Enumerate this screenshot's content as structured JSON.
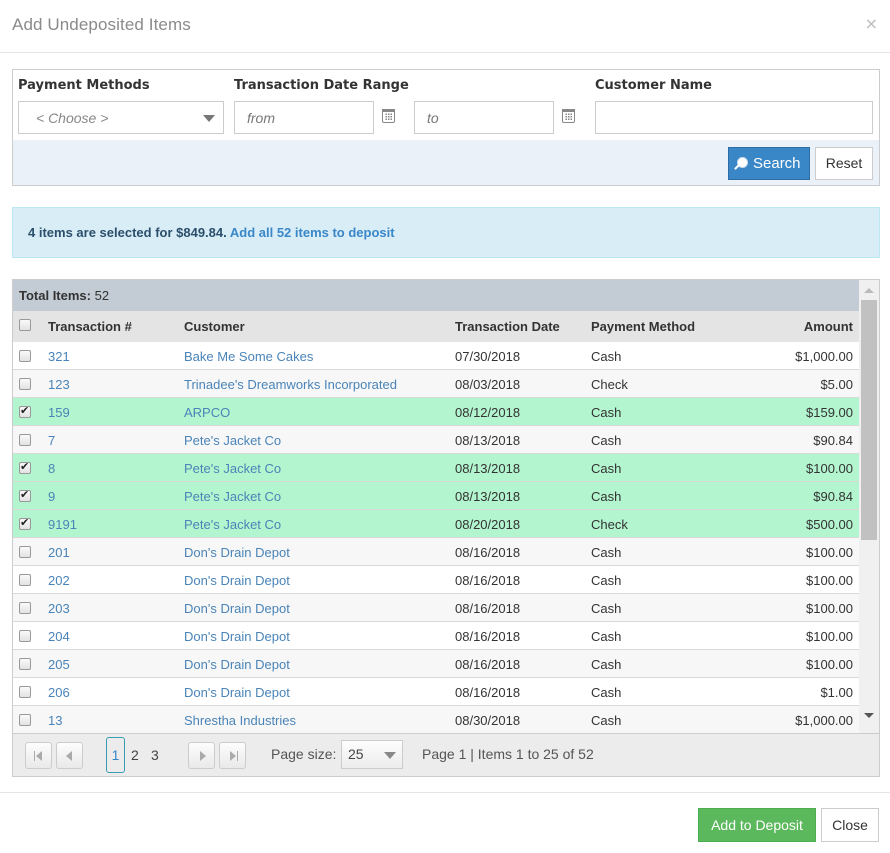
{
  "dialog": {
    "title": "Add Undeposited Items",
    "close_glyph": "×"
  },
  "filters": {
    "payment_methods": {
      "label": "Payment Methods",
      "value": "< Choose >"
    },
    "date_range": {
      "label": "Transaction Date Range",
      "from_placeholder": "from",
      "to_placeholder": "to"
    },
    "customer_name": {
      "label": "Customer Name",
      "value": ""
    },
    "search_label": "Search",
    "reset_label": "Reset"
  },
  "alert": {
    "text": "4 items are selected for $849.84.",
    "link": "Add all 52 items to deposit"
  },
  "grid": {
    "total_label": "Total Items:",
    "total_value": "52",
    "columns": [
      "Transaction #",
      "Customer",
      "Transaction Date",
      "Payment Method",
      "Amount"
    ],
    "rows": [
      {
        "selected": false,
        "txn": "321",
        "customer": "Bake Me Some Cakes",
        "date": "07/30/2018",
        "method": "Cash",
        "amount": "$1,000.00"
      },
      {
        "selected": false,
        "txn": "123",
        "customer": "Trinadee's Dreamworks Incorporated",
        "date": "08/03/2018",
        "method": "Check",
        "amount": "$5.00"
      },
      {
        "selected": true,
        "txn": "159",
        "customer": "ARPCO",
        "date": "08/12/2018",
        "method": "Cash",
        "amount": "$159.00"
      },
      {
        "selected": false,
        "txn": "7",
        "customer": "Pete's Jacket Co",
        "date": "08/13/2018",
        "method": "Cash",
        "amount": "$90.84"
      },
      {
        "selected": true,
        "txn": "8",
        "customer": "Pete's Jacket Co",
        "date": "08/13/2018",
        "method": "Cash",
        "amount": "$100.00"
      },
      {
        "selected": true,
        "txn": "9",
        "customer": "Pete's Jacket Co",
        "date": "08/13/2018",
        "method": "Cash",
        "amount": "$90.84"
      },
      {
        "selected": true,
        "txn": "9191",
        "customer": "Pete's Jacket Co",
        "date": "08/20/2018",
        "method": "Check",
        "amount": "$500.00"
      },
      {
        "selected": false,
        "txn": "201",
        "customer": "Don's Drain Depot",
        "date": "08/16/2018",
        "method": "Cash",
        "amount": "$100.00"
      },
      {
        "selected": false,
        "txn": "202",
        "customer": "Don's Drain Depot",
        "date": "08/16/2018",
        "method": "Cash",
        "amount": "$100.00"
      },
      {
        "selected": false,
        "txn": "203",
        "customer": "Don's Drain Depot",
        "date": "08/16/2018",
        "method": "Cash",
        "amount": "$100.00"
      },
      {
        "selected": false,
        "txn": "204",
        "customer": "Don's Drain Depot",
        "date": "08/16/2018",
        "method": "Cash",
        "amount": "$100.00"
      },
      {
        "selected": false,
        "txn": "205",
        "customer": "Don's Drain Depot",
        "date": "08/16/2018",
        "method": "Cash",
        "amount": "$100.00"
      },
      {
        "selected": false,
        "txn": "206",
        "customer": "Don's Drain Depot",
        "date": "08/16/2018",
        "method": "Cash",
        "amount": "$1.00"
      },
      {
        "selected": false,
        "txn": "13",
        "customer": "Shrestha Industries",
        "date": "08/30/2018",
        "method": "Cash",
        "amount": "$1,000.00"
      }
    ]
  },
  "pager": {
    "pages": [
      "1",
      "2",
      "3"
    ],
    "current_page": "1",
    "page_size_label": "Page size:",
    "page_size": "25",
    "info": "Page 1 | Items 1 to 25 of 52"
  },
  "footer": {
    "add_label": "Add to Deposit",
    "close_label": "Close"
  },
  "colors": {
    "primary": "#3a87c8",
    "success": "#5cb85c",
    "selected_row": "#b3f5cf",
    "alert_bg": "#d9edf7"
  }
}
